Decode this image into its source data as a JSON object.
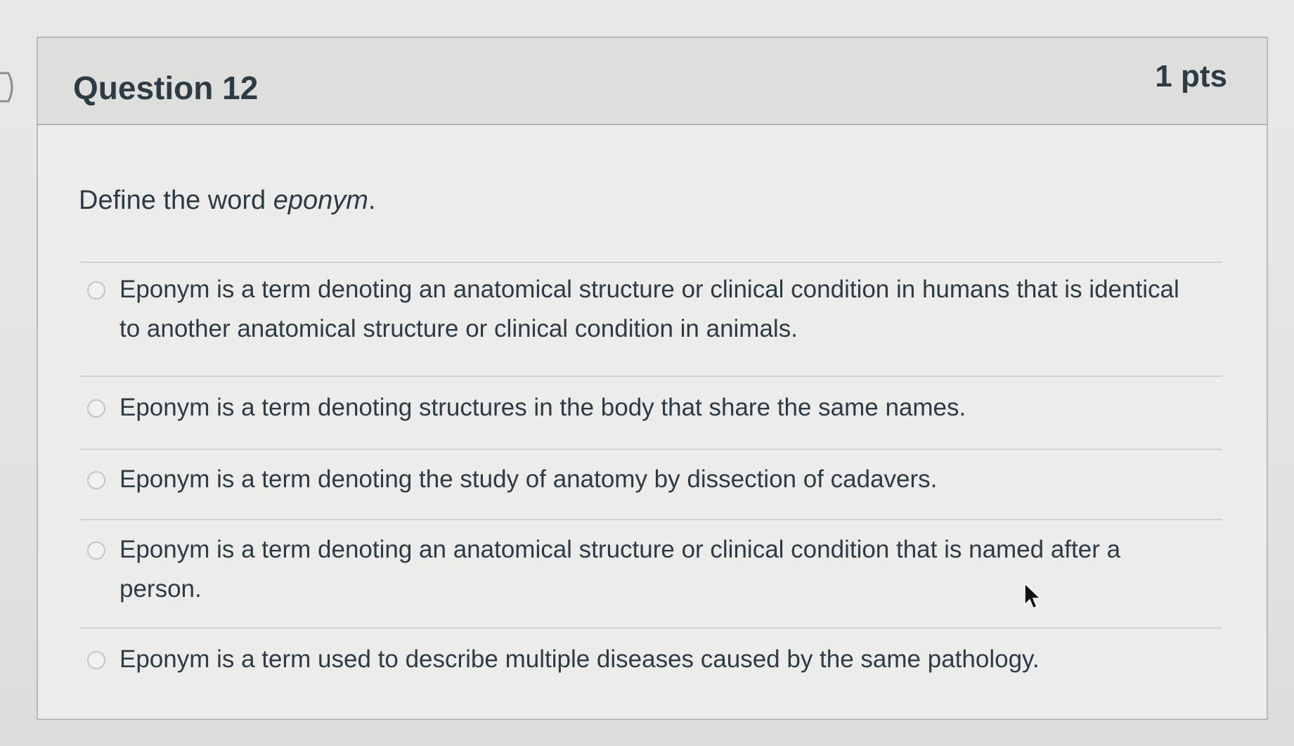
{
  "question": {
    "title": "Question 12",
    "points": "1 pts",
    "prompt_prefix": "Define the word ",
    "prompt_term": "eponym",
    "prompt_suffix": "."
  },
  "answers": [
    {
      "label": "Eponym is a term denoting an anatomical structure or clinical condition in humans that is identical to another anatomical structure or clinical condition in animals.",
      "selected": false
    },
    {
      "label": "Eponym is a term denoting structures in the body that share the same names.",
      "selected": false
    },
    {
      "label": "Eponym is a term denoting the study of anatomy by dissection of cadavers.",
      "selected": false
    },
    {
      "label": "Eponym is a term denoting an anatomical structure or clinical condition that is named after a person.",
      "selected": false
    },
    {
      "label": "Eponym is a term used to describe multiple diseases caused by the same pathology.",
      "selected": false
    }
  ],
  "icons": {
    "side_nav": "chevron-right-icon",
    "pointer": "mouse-pointer-icon",
    "answer_marker": "radio-unchecked-icon"
  },
  "colors": {
    "text": "#2d3b45",
    "header_bg": "#dededc",
    "border": "#b9b9b7"
  }
}
